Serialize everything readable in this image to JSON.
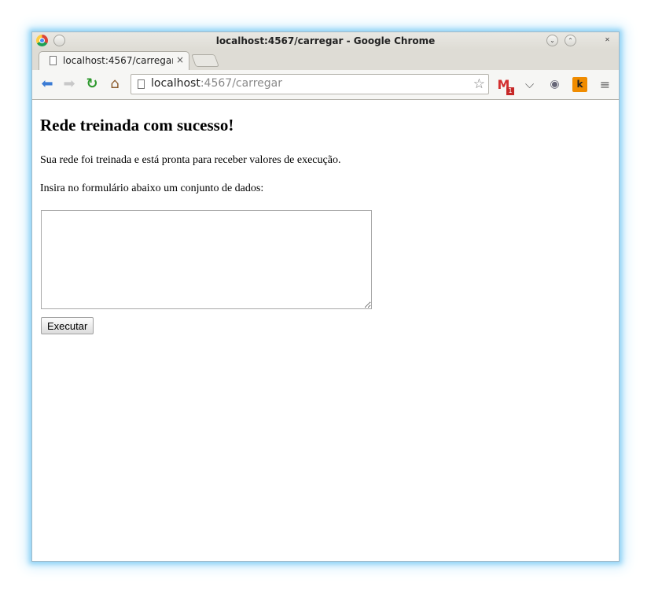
{
  "window": {
    "title": "localhost:4567/carregar - Google Chrome",
    "controls": [
      "⌄",
      "⌃",
      "✕"
    ]
  },
  "tabs": [
    {
      "label": "localhost:4567/carregar",
      "close": "×"
    }
  ],
  "toolbar": {
    "url_host": "localhost",
    "url_rest": ":4567/carregar",
    "gmail_badge": "1",
    "ext_k": "k"
  },
  "page": {
    "heading": "Rede treinada com sucesso!",
    "paragraph1": "Sua rede foi treinada e está pronta para receber valores de execução.",
    "paragraph2": "Insira no formulário abaixo um conjunto de dados:",
    "textarea_value": "",
    "button_label": "Executar"
  }
}
